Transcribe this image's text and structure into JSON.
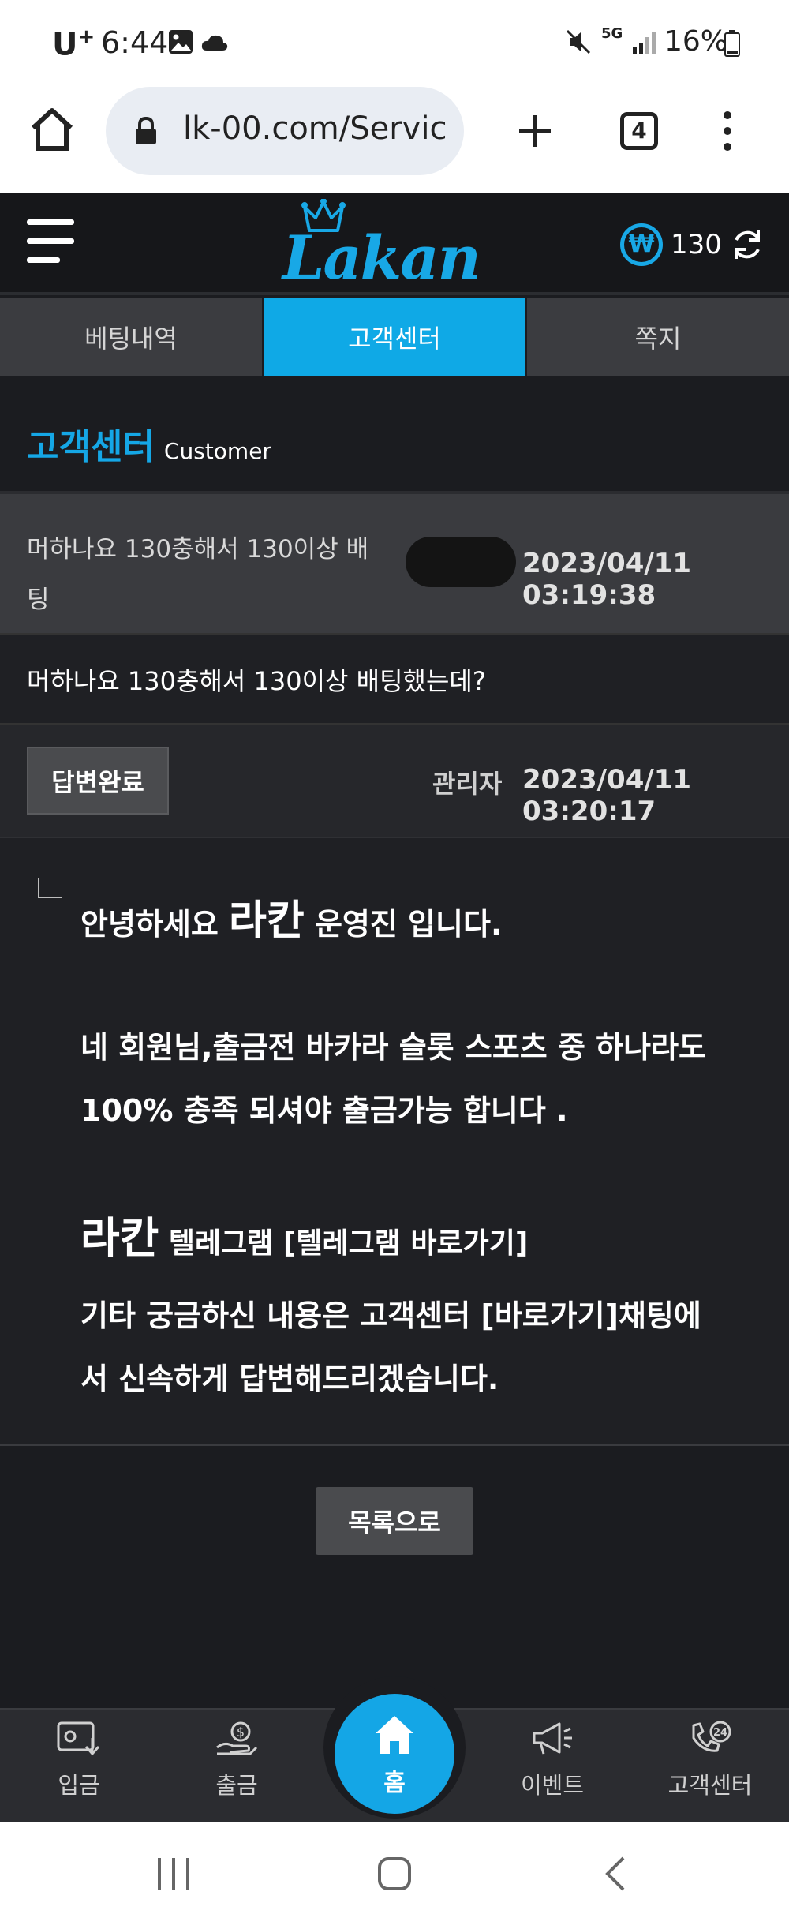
{
  "status_bar": {
    "carrier": "U",
    "carrier_sup": "+",
    "time": "6:44",
    "network": "5G",
    "battery": "16%"
  },
  "browser": {
    "url": "lk-00.com/Servic",
    "tab_count": "4"
  },
  "header": {
    "logo_text": "Lakan",
    "balance_currency": "₩",
    "balance": "130"
  },
  "tabs": [
    {
      "label": "베팅내역",
      "active": false
    },
    {
      "label": "고객센터",
      "active": true
    },
    {
      "label": "쪽지",
      "active": false
    }
  ],
  "section": {
    "title": "고객센터",
    "subtitle": "Customer"
  },
  "post": {
    "subject": "머하나요 130충해서 130이상 배팅",
    "date": "2023/04/11 03:19:38",
    "content": "머하나요 130충해서 130이상 배팅했는데?"
  },
  "answer": {
    "status": "답변완료",
    "author": "관리자",
    "date": "2023/04/11 03:20:17",
    "line1_pre": "안녕하세요 ",
    "line1_brand": "라칸",
    "line1_post": " 운영진 입니다.",
    "line2": "네 회원님,출금전 바카라 슬롯 스포츠 중 하나라도",
    "line3": "100% 충족 되셔야 출금가능 합니다 .",
    "line4_brand": "라칸",
    "line4_post": " 텔레그램 [텔레그램  바로가기]",
    "line5": "기타 궁금하신 내용은 고객센터  [바로가기]채팅에",
    "line6": "서 신속하게 답변해드리겠습니다."
  },
  "list_button": "목록으로",
  "bottom_nav": {
    "deposit": "입금",
    "withdraw": "출금",
    "home": "홈",
    "event": "이벤트",
    "support": "고객센터",
    "support_badge": "24"
  },
  "colors": {
    "accent": "#0fa9e6",
    "background": "#1b1c20",
    "panel": "#3a3b3f"
  }
}
